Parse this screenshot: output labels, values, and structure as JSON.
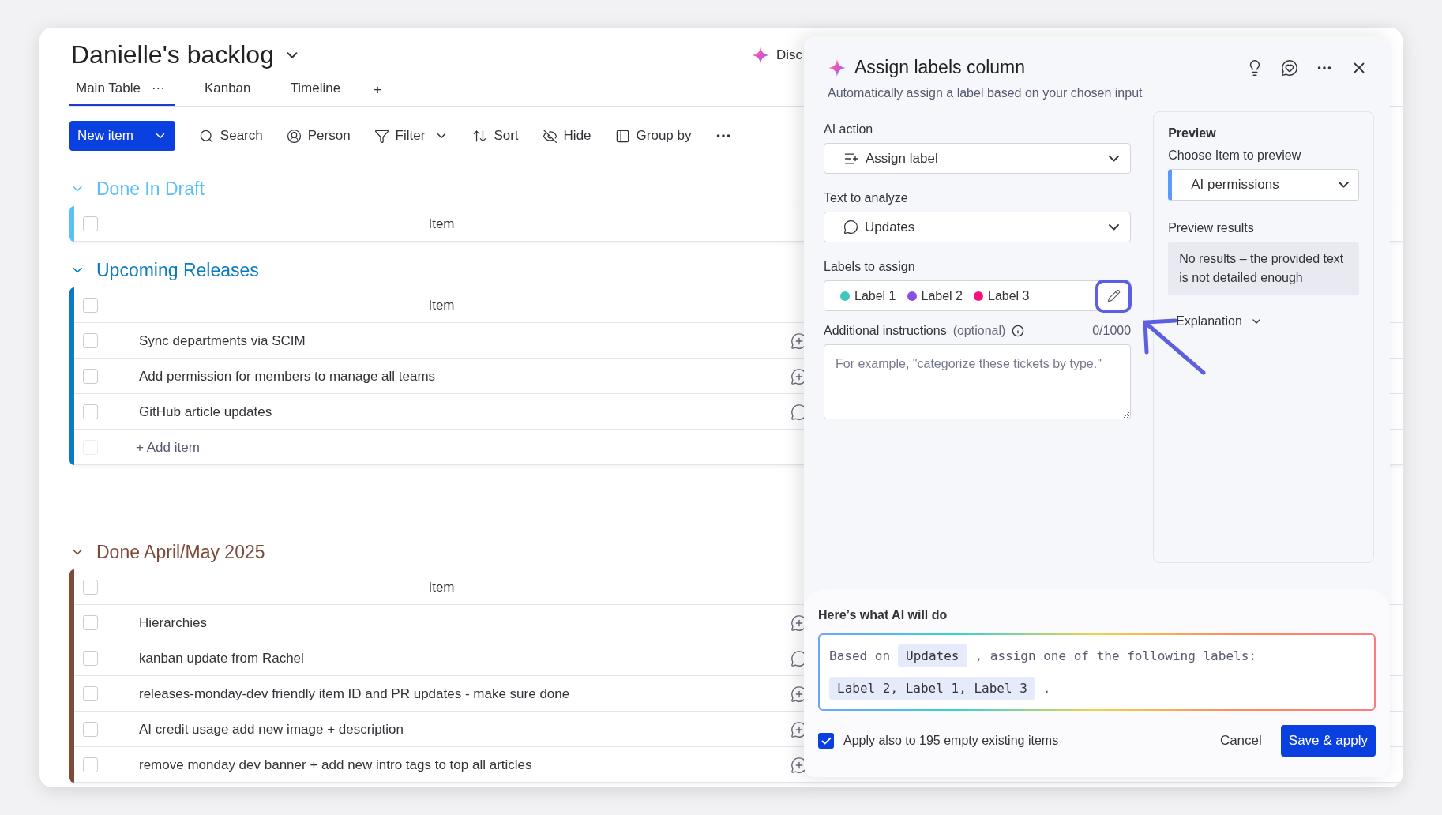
{
  "board": {
    "title": "Danielle's backlog",
    "views": [
      {
        "label": "Main Table",
        "selected": true,
        "menu": "···"
      },
      {
        "label": "Kanban",
        "selected": false
      },
      {
        "label": "Timeline",
        "selected": false
      }
    ],
    "add_view": "+",
    "ai_link": "Disc"
  },
  "toolbar": {
    "new_item": "New item",
    "tools": [
      {
        "kind": "search",
        "label": "Search"
      },
      {
        "kind": "person",
        "label": "Person"
      },
      {
        "kind": "filter",
        "label": "Filter"
      },
      {
        "kind": "sort",
        "label": "Sort"
      },
      {
        "kind": "hide",
        "label": "Hide"
      },
      {
        "kind": "group",
        "label": "Group by"
      }
    ]
  },
  "groups": [
    {
      "title": "Done In Draft",
      "color": "#5bc0f8",
      "header": {
        "label": "Item",
        "checked": false
      }
    },
    {
      "title": "Upcoming Releases",
      "color": "#0a7bc0",
      "header": {
        "label": "Item",
        "checked": false
      },
      "add_row": {
        "label": "+ Add item",
        "checked": false
      },
      "items": [
        {
          "name": "Sync departments via SCIM",
          "checked": false,
          "kind": "add"
        },
        {
          "name": "Add permission for members to manage all teams",
          "checked": false,
          "kind": "add"
        },
        {
          "name": "GitHub article updates",
          "checked": false,
          "kind": "comment"
        }
      ]
    },
    {
      "title": "Done April/May 2025",
      "color": "#7e4b3a",
      "header": {
        "label": "Item",
        "checked": false
      },
      "items": [
        {
          "name": "Hierarchies",
          "checked": false,
          "kind": "add"
        },
        {
          "name": "kanban update from Rachel",
          "checked": false,
          "kind": "comment"
        },
        {
          "name": "releases-monday-dev friendly item ID and PR updates - make sure done",
          "checked": false,
          "kind": "add"
        },
        {
          "name": "AI credit usage add new image + description",
          "checked": false,
          "kind": "add"
        },
        {
          "name": "remove monday dev banner + add new intro tags to top all articles",
          "checked": false,
          "kind": "add"
        }
      ]
    }
  ],
  "panel": {
    "title": "Assign labels column",
    "subtitle": "Automatically assign a label based on your chosen input",
    "ai_action": {
      "label": "AI action",
      "value": "Assign label"
    },
    "text_to_analyze": {
      "label": "Text to analyze",
      "value": "Updates"
    },
    "labels_to_assign": {
      "label": "Labels to assign",
      "labels": [
        {
          "name": "Label 1",
          "color": "#3ec6bf"
        },
        {
          "name": "Label 2",
          "color": "#8a4fe0"
        },
        {
          "name": "Label 3",
          "color": "#f5127a"
        }
      ]
    },
    "instructions": {
      "label": "Additional instructions",
      "optional": "(optional)",
      "counter": "0/1000",
      "placeholder": "For example, \"categorize these tickets by type.\""
    },
    "preview": {
      "title": "Preview",
      "choose_label": "Choose Item to preview",
      "item": "AI permissions",
      "results_label": "Preview results",
      "result": "No results – the provided text is not detailed enough",
      "explanation": "Explanation"
    },
    "summary": {
      "heading": "Here’s what AI will do",
      "prompt": [
        {
          "kind": "text",
          "text": "Based on"
        },
        {
          "kind": "chip",
          "text": "Updates"
        },
        {
          "kind": "text",
          "text": ", assign one of the following labels:"
        },
        {
          "kind": "chip",
          "text": "Label 2, Label 1, Label 3"
        },
        {
          "kind": "text",
          "text": "."
        }
      ],
      "apply": {
        "label": "Apply also to 195 empty existing items",
        "checked": true
      },
      "cancel": "Cancel",
      "save": "Save & apply"
    }
  }
}
